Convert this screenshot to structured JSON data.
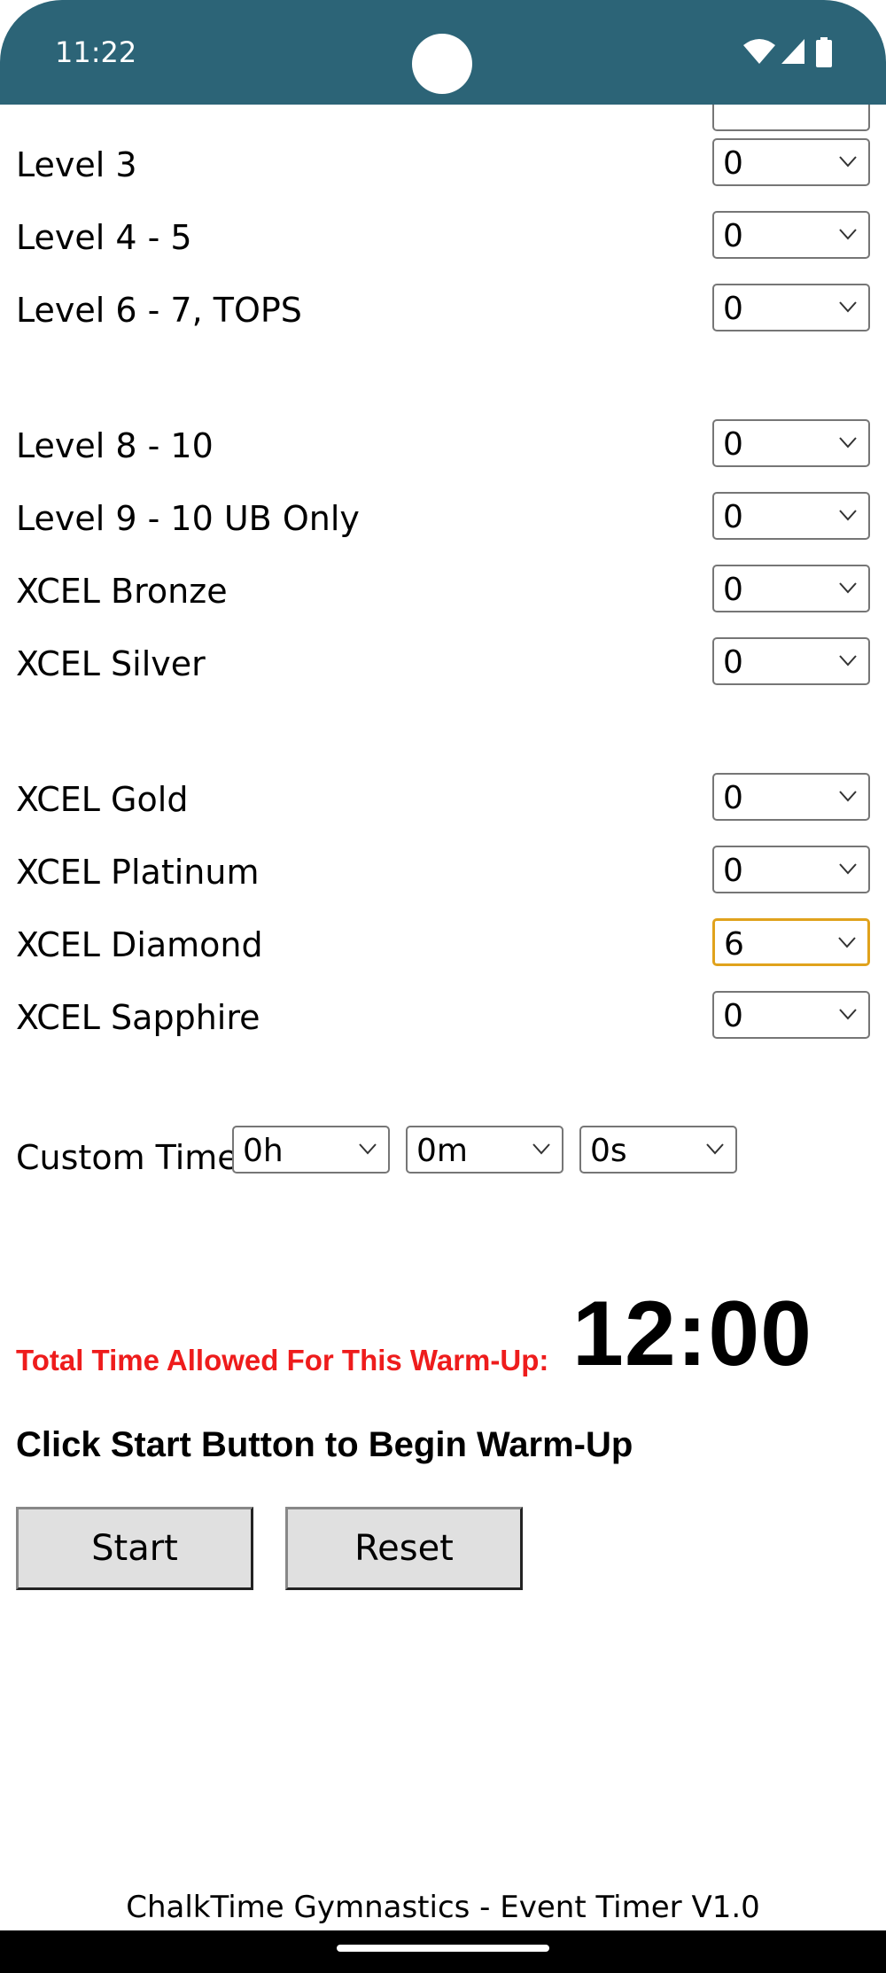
{
  "status_bar": {
    "time": "11:22",
    "icons": [
      "wifi-icon",
      "signal-icon",
      "battery-icon"
    ],
    "color": "#2c6477"
  },
  "levels": [
    {
      "label": "Level 3",
      "value": "0"
    },
    {
      "label": "Level 4 - 5",
      "value": "0"
    },
    {
      "label": "Level 6 - 7, TOPS",
      "value": "0"
    },
    {
      "label": "Level 8 - 10",
      "value": "0"
    },
    {
      "label": "Level 9 - 10 UB Only",
      "value": "0"
    },
    {
      "label": "XCEL Bronze",
      "value": "0"
    },
    {
      "label": "XCEL Silver",
      "value": "0"
    },
    {
      "label": "XCEL Gold",
      "value": "0"
    },
    {
      "label": "XCEL Platinum",
      "value": "0"
    },
    {
      "label": "XCEL Diamond",
      "value": "6"
    },
    {
      "label": "XCEL Sapphire",
      "value": "0"
    }
  ],
  "custom_time": {
    "label": "Custom Time:",
    "hours": "0h",
    "minutes": "0m",
    "seconds": "0s"
  },
  "total": {
    "label": "Total Time Allowed For This Warm-Up:",
    "value": "12:00",
    "label_color": "#ee1c1c"
  },
  "instruction": "Click Start Button to Begin Warm-Up",
  "buttons": {
    "start": "Start",
    "reset": "Reset"
  },
  "footer": "ChalkTime Gymnastics - Event Timer V1.0",
  "focus_color": "#e0a21c"
}
